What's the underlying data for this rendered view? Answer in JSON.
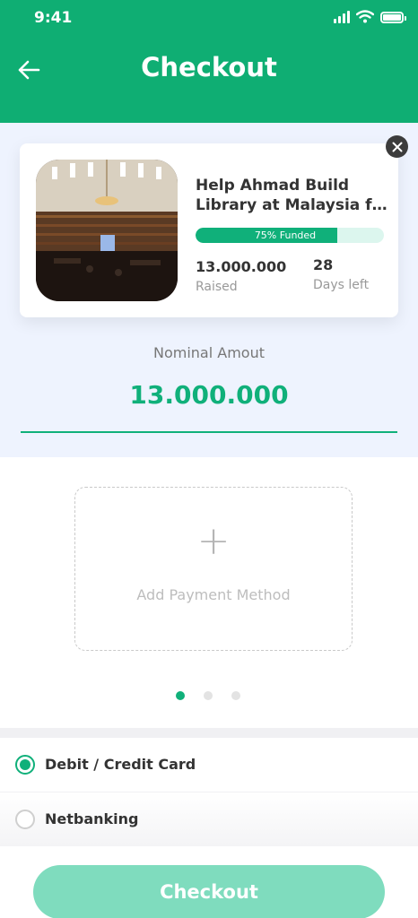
{
  "status_bar": {
    "time": "9:41"
  },
  "header": {
    "title": "Checkout"
  },
  "campaign": {
    "title_line1": "Help Ahmad Build",
    "title_line2": "Library at Malaysia for...",
    "funded_fraction": 0.75,
    "funded_label": "75% Funded",
    "raised_value": "13.000.000",
    "raised_label": "Raised",
    "days_value": "28",
    "days_label": "Days left"
  },
  "nominal": {
    "label": "Nominal Amout",
    "value": "13.000.000"
  },
  "payment": {
    "add_label": "Add Payment Method",
    "carousel_active": 0,
    "carousel_count": 3
  },
  "methods": [
    {
      "label": "Debit / Credit Card",
      "selected": true
    },
    {
      "label": "Netbanking",
      "selected": false
    }
  ],
  "footer": {
    "checkout_label": "Checkout"
  },
  "colors": {
    "brand": "#0fae73",
    "accent": "#10b07a",
    "button": "#7fdcbe"
  }
}
